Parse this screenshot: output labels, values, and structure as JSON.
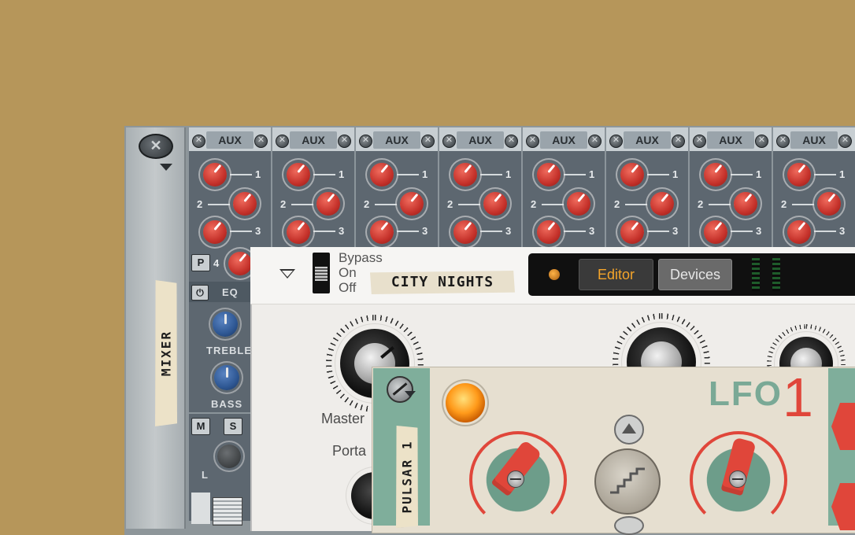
{
  "mixer": {
    "label": "MIXER",
    "channels": [
      {
        "aux_label": "AUX"
      },
      {
        "aux_label": "AUX"
      },
      {
        "aux_label": "AUX"
      },
      {
        "aux_label": "AUX"
      },
      {
        "aux_label": "AUX"
      },
      {
        "aux_label": "AUX"
      },
      {
        "aux_label": "AUX"
      },
      {
        "aux_label": "AUX"
      }
    ],
    "send_numbers": [
      "1",
      "2",
      "3",
      "4"
    ],
    "p_button": "P",
    "eq_label": "EQ",
    "power_icon": "⏻",
    "treble_label": "TREBLE",
    "bass_label": "BASS",
    "m_button": "M",
    "s_button": "S",
    "pan_label": "L"
  },
  "synth": {
    "bypass": "Bypass",
    "on": "On",
    "off": "Off",
    "patch_name": "CITY NIGHTS",
    "editor_tab": "Editor",
    "devices_tab": "Devices",
    "master_label": "Master",
    "porta_label": "Porta"
  },
  "pulsar": {
    "name": "PULSAR 1",
    "lfo_title": "LFO",
    "lfo_number": "1"
  },
  "colors": {
    "background": "#b6965a",
    "send_knob": "#d0392f",
    "accent_orange": "#f4a42a",
    "pulsar_teal": "#7fae9b",
    "pulsar_red": "#e0463a"
  }
}
